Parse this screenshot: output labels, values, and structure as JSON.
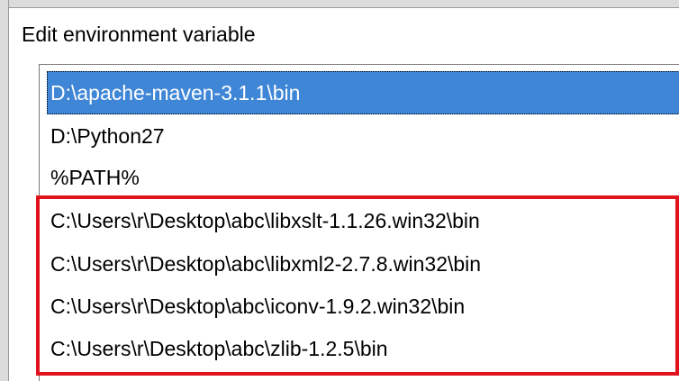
{
  "window": {
    "title": "Edit environment variable"
  },
  "path_list": {
    "items": [
      {
        "label": "D:\\apache-maven-3.1.1\\bin",
        "selected": true
      },
      {
        "label": "D:\\Python27",
        "selected": false
      },
      {
        "label": "%PATH%",
        "selected": false
      },
      {
        "label": "C:\\Users\\r\\Desktop\\abc\\libxslt-1.1.26.win32\\bin",
        "selected": false
      },
      {
        "label": "C:\\Users\\r\\Desktop\\abc\\libxml2-2.7.8.win32\\bin",
        "selected": false
      },
      {
        "label": "C:\\Users\\r\\Desktop\\abc\\iconv-1.9.2.win32\\bin",
        "selected": false
      },
      {
        "label": "C:\\Users\\r\\Desktop\\abc\\zlib-1.2.5\\bin",
        "selected": false
      }
    ]
  },
  "colors": {
    "selection": "#3f86d7",
    "highlight_annotation": "#e0131c"
  }
}
